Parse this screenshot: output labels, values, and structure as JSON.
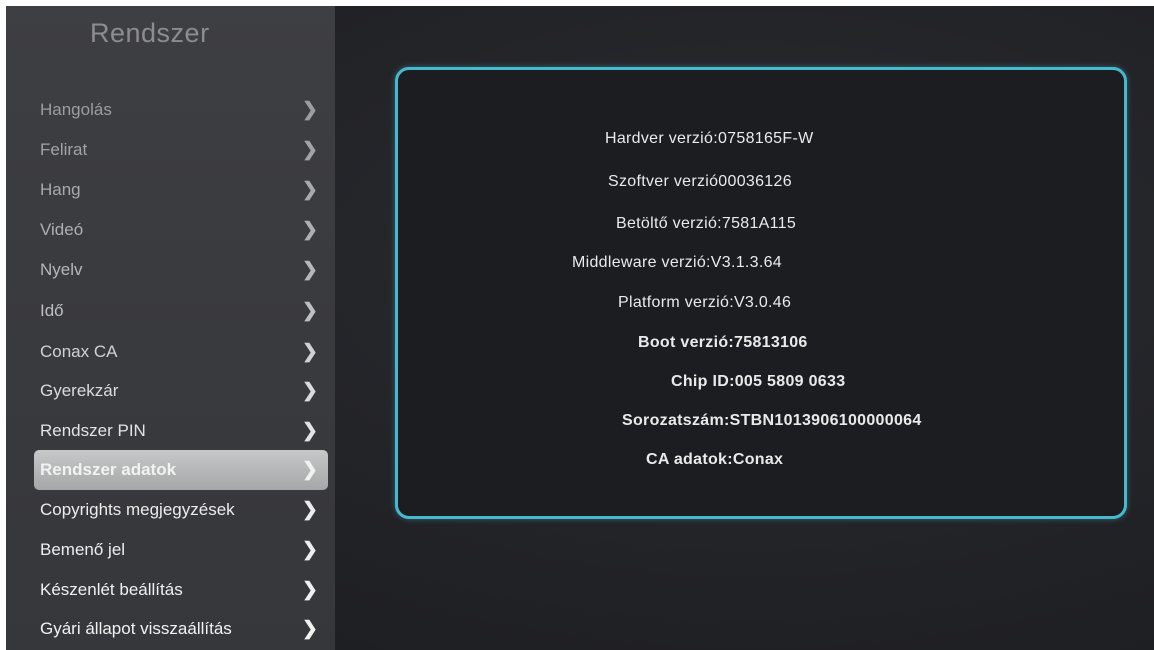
{
  "sidebar": {
    "title": "Rendszer",
    "items": [
      {
        "label": "Hangolás",
        "chevron": "❯",
        "color": "#9c9d9f"
      },
      {
        "label": "Felirat",
        "chevron": "❯",
        "color": "#a2a3a5"
      },
      {
        "label": "Hang",
        "chevron": "❯",
        "color": "#a8a9ab"
      },
      {
        "label": "Videó",
        "chevron": "❯",
        "color": "#aeafb1"
      },
      {
        "label": "Nyelv",
        "chevron": "❯",
        "color": "#b6b7b9"
      },
      {
        "label": "Idő",
        "chevron": "❯",
        "color": "#bebfc1"
      },
      {
        "label": "Conax CA",
        "chevron": "❯",
        "color": "#d0d1d3"
      },
      {
        "label": "Gyerekzár",
        "chevron": "❯",
        "color": "#dadbdd"
      },
      {
        "label": "Rendszer PIN",
        "chevron": "❯",
        "color": "#e2e3e5"
      },
      {
        "label": "Rendszer adatok",
        "chevron": "❯",
        "color": "#f2f2f2",
        "selected": true
      },
      {
        "label": "Copyrights megjegyzések",
        "chevron": "❯",
        "color": "#ececec"
      },
      {
        "label": "Bemenő jel",
        "chevron": "❯",
        "color": "#eeeeee"
      },
      {
        "label": "Készenlét beállítás",
        "chevron": "❯",
        "color": "#f0f0f0"
      },
      {
        "label": "Gyári állapot visszaállítás",
        "chevron": "❯",
        "color": "#f2f2f2"
      }
    ]
  },
  "info": {
    "lines": [
      "Hardver verzió:0758165F-W",
      "Szoftver verzió00036126",
      "Betöltő verzió:7581A115",
      "Middleware verzió:V3.1.3.64",
      "Platform verzió:V3.0.46",
      "Boot verzió:75813106",
      "Chip ID:005 5809 0633",
      "Sorozatszám:STBN1013906100000064",
      "CA adatok:Conax"
    ]
  },
  "colors": {
    "accent_border": "#47b9cf",
    "selected_bg": "#b5b6b7",
    "panel_bg": "#1c1d21",
    "sidebar_bg": "#3a3b3f"
  }
}
